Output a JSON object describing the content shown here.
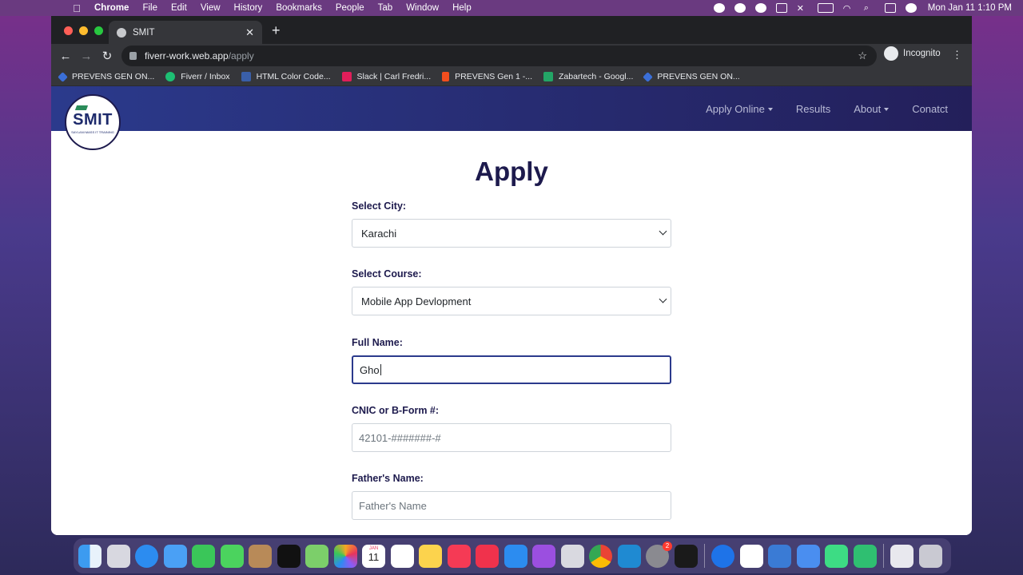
{
  "menubar": {
    "app": "Chrome",
    "items": [
      "File",
      "Edit",
      "View",
      "History",
      "Bookmarks",
      "People",
      "Tab",
      "Window",
      "Help"
    ],
    "clock": "Mon Jan 11  1:10 PM"
  },
  "browser": {
    "tab_title": "SMIT",
    "url_host": "fiverr-work.web.app",
    "url_path": "/apply",
    "profile": "Incognito",
    "bookmarks": [
      {
        "label": "PREVENS GEN ON...",
        "color": "#3b6fd8"
      },
      {
        "label": "Fiverr / Inbox",
        "color": "#1dbf73"
      },
      {
        "label": "HTML Color Code...",
        "color": "#3a5fa8"
      },
      {
        "label": "Slack | Carl Fredri...",
        "color": "#e01e5a"
      },
      {
        "label": "PREVENS Gen 1 -...",
        "color": "#f24e1e"
      },
      {
        "label": "Zabartech - Googl...",
        "color": "#23a566"
      },
      {
        "label": "PREVENS GEN ON...",
        "color": "#3b6fd8"
      }
    ]
  },
  "site": {
    "logo_text": "SMIT",
    "logo_subtext": "SAYLANI MASS IT TRAINING",
    "nav": {
      "apply": "Apply Online",
      "results": "Results",
      "about": "About",
      "contact": "Conatct"
    }
  },
  "form": {
    "title": "Apply",
    "city_label": "Select City:",
    "city_value": "Karachi",
    "course_label": "Select Course:",
    "course_value": "Mobile App Devlopment",
    "name_label": "Full Name:",
    "name_value": "Gho",
    "cnic_label": "CNIC or B-Form #:",
    "cnic_placeholder": "42101-#######-#",
    "father_label": "Father's Name:",
    "father_placeholder": "Father's Name"
  },
  "dock": {
    "calendar_month": "JAN",
    "calendar_day": "11",
    "settings_badge": "2"
  },
  "colors": {
    "brand_navy": "#1d1a4d",
    "nav_gradient_start": "#2b3a8c",
    "nav_gradient_end": "#231f5a",
    "focus_border": "#2b3a8c"
  }
}
